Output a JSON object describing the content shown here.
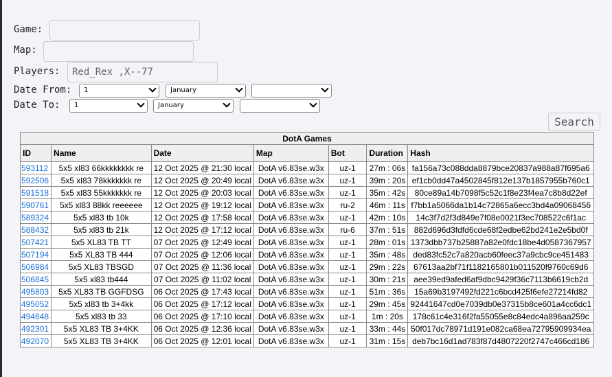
{
  "form": {
    "game_label": "Game:",
    "game_value": "",
    "map_label": "Map:",
    "map_value": "",
    "players_label": "Players:",
    "players_value": "Red_Rex ,X--77",
    "date_from_label": "Date From:",
    "date_from": {
      "day": "1",
      "month": "January",
      "year": ""
    },
    "date_to_label": "Date To:",
    "date_to": {
      "day": "1",
      "month": "January",
      "year": ""
    },
    "search_label": "Search"
  },
  "table": {
    "title": "DotA Games",
    "columns": [
      "ID",
      "Name",
      "Date",
      "Map",
      "Bot",
      "Duration",
      "Hash"
    ],
    "rows": [
      [
        "593112",
        "5x5 xl83 66kkkkkkkk re",
        "12 Oct 2025 @ 21:30 local",
        "DotA v6.83se.w3x",
        "uz-1",
        "27m : 06s",
        "fa156a73c088dda8879bce20837a988a87f695a6"
      ],
      [
        "592506",
        "5x5 xl83 78kkkkkkk re",
        "12 Oct 2025 @ 20:49 local",
        "DotA v6.83se.w3x",
        "uz-1",
        "39m : 20s",
        "ef1cb0dd47a4502845f812e137b1857955b760c1"
      ],
      [
        "591518",
        "5x5 xl83 55kkkkkkk re",
        "12 Oct 2025 @ 20:03 local",
        "DotA v6.83se.w3x",
        "uz-1",
        "35m : 42s",
        "80ce89a14b7098f5c52c1f8e23f4ea7c8b8d22ef"
      ],
      [
        "590761",
        "5x5 xl83 88kk reeeeee",
        "12 Oct 2025 @ 19:12 local",
        "DotA v6.83se.w3x",
        "ru-2",
        "46m : 11s",
        "f7bb1a5066da1b14c72865a6ecc3bd4a09068456"
      ],
      [
        "589324",
        "5x5 xl83 tb 10k",
        "12 Oct 2025 @ 17:58 local",
        "DotA v6.83se.w3x",
        "uz-1",
        "42m : 10s",
        "14c3f7d2f3d849e7f08e0021f3ec708522c6f1ac"
      ],
      [
        "588432",
        "5x5 xl83 tb 21k",
        "12 Oct 2025 @ 17:12 local",
        "DotA v6.83se.w3x",
        "ru-6",
        "37m : 51s",
        "882d696d3fdfd6cde68f2edbe62bd241e2e5bd0f"
      ],
      [
        "507421",
        "5x5 XL83 TB TT",
        "07 Oct 2025 @ 12:49 local",
        "DotA v6.83se.w3x",
        "uz-1",
        "28m : 01s",
        "1373dbb737b25887a82e0fdc18be4d0587367957"
      ],
      [
        "507194",
        "5x5 XL83 TB 444",
        "07 Oct 2025 @ 12:06 local",
        "DotA v6.83se.w3x",
        "uz-1",
        "35m : 48s",
        "ded83fc52c7a820acb60feec37a9cbc9ce451483"
      ],
      [
        "506984",
        "5x5 XL83 TBSGD",
        "07 Oct 2025 @ 11:36 local",
        "DotA v6.83se.w3x",
        "uz-1",
        "29m : 22s",
        "67613aa2bf71f1182165801b011520f9760c69d6"
      ],
      [
        "506845",
        "5x5 xl83 tb444",
        "07 Oct 2025 @ 11:02 local",
        "DotA v6.83se.w3x",
        "uz-1",
        "30m : 21s",
        "aee39ed9afed6af9dbc9429f36c7113b6619cb2d"
      ],
      [
        "495803",
        "5x5 XL83 TB GGFDSG",
        "06 Oct 2025 @ 17:43 local",
        "DotA v6.83se.w3x",
        "uz-1",
        "51m : 36s",
        "15a69b3197492fd221c6bcd425f6efe27214fd82"
      ],
      [
        "495052",
        "5x5 xl83 tb 3+4kk",
        "06 Oct 2025 @ 17:12 local",
        "DotA v6.83se.w3x",
        "uz-1",
        "29m : 45s",
        "92441647cd0e7039db0e37315b8ce601a4cc6dc1"
      ],
      [
        "494648",
        "5x5 xl83 tb 33",
        "06 Oct 2025 @ 17:10 local",
        "DotA v6.83se.w3x",
        "uz-1",
        "1m : 20s",
        "178c61c4e316f2fa55055e8c84edc4a896aa259c"
      ],
      [
        "492301",
        "5x5 XL83 TB 3+4KK",
        "06 Oct 2025 @ 12:36 local",
        "DotA v6.83se.w3x",
        "uz-1",
        "33m : 44s",
        "50f017dc78971d191e082ca68ea72795909934ea"
      ],
      [
        "492070",
        "5x5 XL83 TB 3+4KK",
        "06 Oct 2025 @ 12:01 local",
        "DotA v6.83se.w3x",
        "uz-1",
        "31m : 15s",
        "deb7bc16d1ad783f87d4807220f2747c466cd186"
      ]
    ]
  }
}
